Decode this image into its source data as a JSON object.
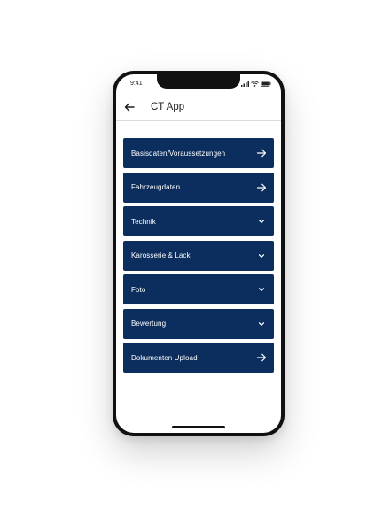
{
  "status_bar": {
    "time": "9:41",
    "icons": [
      "signal-icon",
      "wifi-icon",
      "battery-icon"
    ]
  },
  "app_bar": {
    "back_icon": "arrow-left-icon",
    "title": "CT App"
  },
  "menu": {
    "items": [
      {
        "label": "Basisdaten/Voraussetzungen",
        "icon": "arrow-right-icon"
      },
      {
        "label": "Fahrzeugdaten",
        "icon": "arrow-right-icon"
      },
      {
        "label": "Technik",
        "icon": "chevron-down-icon"
      },
      {
        "label": "Karosserie & Lack",
        "icon": "chevron-down-icon"
      },
      {
        "label": "Foto",
        "icon": "chevron-down-icon"
      },
      {
        "label": "Bewertung",
        "icon": "chevron-down-icon"
      },
      {
        "label": "Dokumenten Upload",
        "icon": "arrow-right-icon"
      }
    ]
  },
  "colors": {
    "item_background": "#0b2e5e",
    "item_text": "#ffffff",
    "frame": "#111111"
  }
}
